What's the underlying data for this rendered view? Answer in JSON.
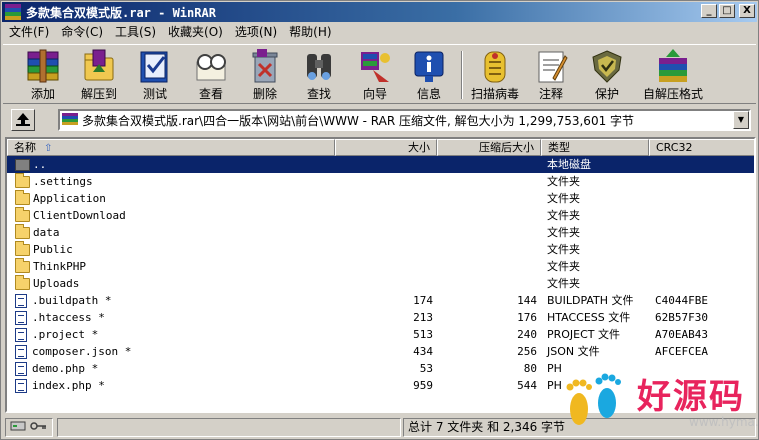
{
  "window": {
    "title": "多款集合双模式版.rar - WinRAR",
    "controls": {
      "minimize": "_",
      "maximize": "□",
      "close": "X"
    }
  },
  "menu": [
    {
      "label": "文件(F)"
    },
    {
      "label": "命令(C)"
    },
    {
      "label": "工具(S)"
    },
    {
      "label": "收藏夹(O)"
    },
    {
      "label": "选项(N)"
    },
    {
      "label": "帮助(H)"
    }
  ],
  "toolbar": [
    {
      "label": "添加",
      "icon": "add-archive-icon"
    },
    {
      "label": "解压到",
      "icon": "extract-to-icon"
    },
    {
      "label": "测试",
      "icon": "test-icon"
    },
    {
      "label": "查看",
      "icon": "view-icon"
    },
    {
      "label": "删除",
      "icon": "delete-icon"
    },
    {
      "label": "查找",
      "icon": "find-icon"
    },
    {
      "label": "向导",
      "icon": "wizard-icon"
    },
    {
      "label": "信息",
      "icon": "info-icon"
    },
    {
      "label": "扫描病毒",
      "icon": "virus-scan-icon"
    },
    {
      "label": "注释",
      "icon": "comment-icon"
    },
    {
      "label": "保护",
      "icon": "protect-icon"
    },
    {
      "label": "自解压格式",
      "icon": "sfx-icon"
    }
  ],
  "address": {
    "path": "多款集合双模式版.rar\\四合一版本\\网站\\前台\\WWW - RAR 压缩文件, 解包大小为 1,299,753,601 字节"
  },
  "columns": {
    "name": "名称",
    "size": "大小",
    "packed": "压缩后大小",
    "type": "类型",
    "crc": "CRC32"
  },
  "files": [
    {
      "name": "..",
      "size": "",
      "packed": "",
      "type": "本地磁盘",
      "crc": "",
      "kind": "updir",
      "selected": true
    },
    {
      "name": ".settings",
      "size": "",
      "packed": "",
      "type": "文件夹",
      "crc": "",
      "kind": "folder"
    },
    {
      "name": "Application",
      "size": "",
      "packed": "",
      "type": "文件夹",
      "crc": "",
      "kind": "folder"
    },
    {
      "name": "ClientDownload",
      "size": "",
      "packed": "",
      "type": "文件夹",
      "crc": "",
      "kind": "folder"
    },
    {
      "name": "data",
      "size": "",
      "packed": "",
      "type": "文件夹",
      "crc": "",
      "kind": "folder"
    },
    {
      "name": "Public",
      "size": "",
      "packed": "",
      "type": "文件夹",
      "crc": "",
      "kind": "folder"
    },
    {
      "name": "ThinkPHP",
      "size": "",
      "packed": "",
      "type": "文件夹",
      "crc": "",
      "kind": "folder"
    },
    {
      "name": "Uploads",
      "size": "",
      "packed": "",
      "type": "文件夹",
      "crc": "",
      "kind": "folder"
    },
    {
      "name": ".buildpath *",
      "size": "174",
      "packed": "144",
      "type": "BUILDPATH 文件",
      "crc": "C4044FBE",
      "kind": "file"
    },
    {
      "name": ".htaccess *",
      "size": "213",
      "packed": "176",
      "type": "HTACCESS 文件",
      "crc": "62B57F30",
      "kind": "file"
    },
    {
      "name": ".project *",
      "size": "513",
      "packed": "240",
      "type": "PROJECT 文件",
      "crc": "A70EAB43",
      "kind": "file"
    },
    {
      "name": "composer.json *",
      "size": "434",
      "packed": "256",
      "type": "JSON 文件",
      "crc": "AFCEFCEA",
      "kind": "file"
    },
    {
      "name": "demo.php *",
      "size": "53",
      "packed": "80",
      "type": "PH",
      "crc": "",
      "kind": "file"
    },
    {
      "name": "index.php *",
      "size": "959",
      "packed": "544",
      "type": "PH",
      "crc": "",
      "kind": "file"
    }
  ],
  "status": {
    "summary": "总计 7 文件夹 和 2,346 字节"
  },
  "watermark": {
    "brand": "好源码",
    "url": "www.hyma.vip"
  }
}
